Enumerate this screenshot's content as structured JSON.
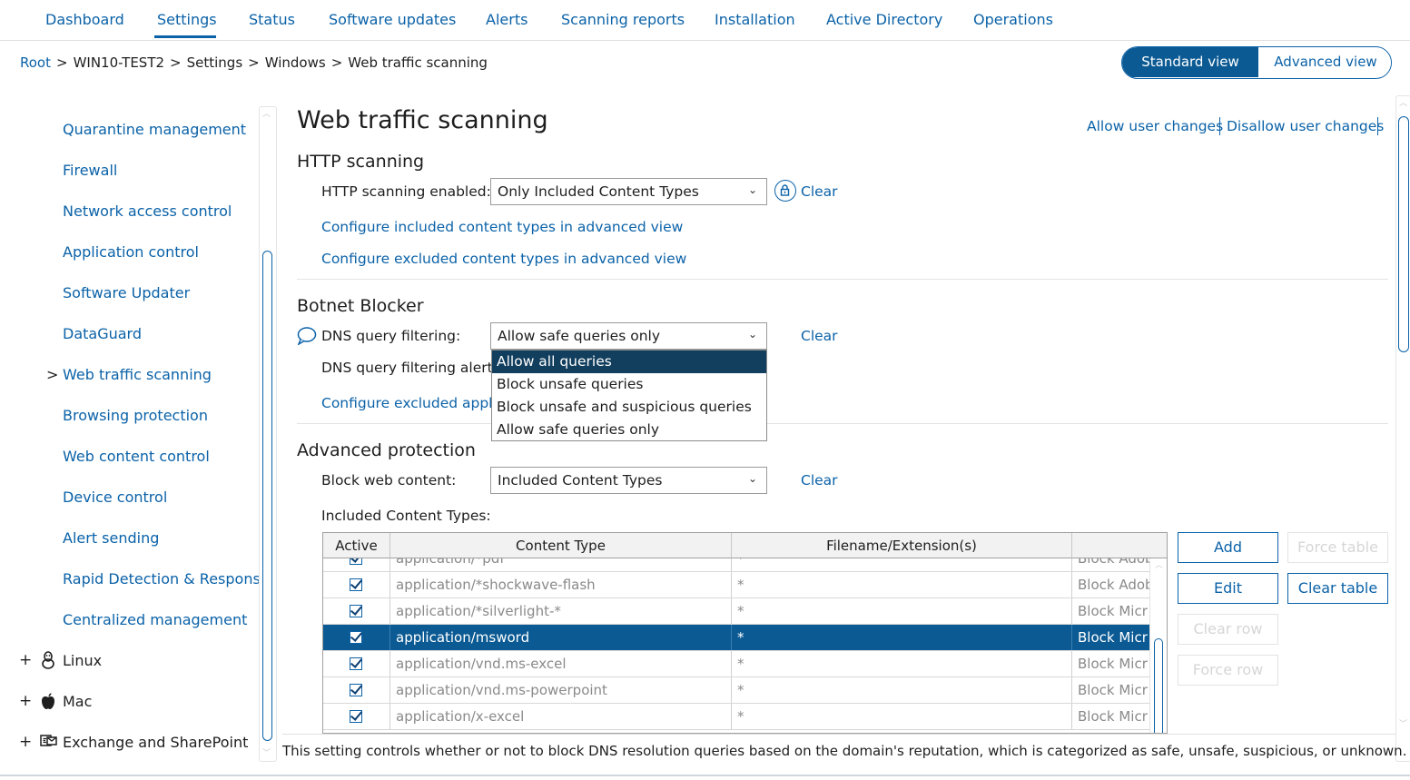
{
  "nav": {
    "tabs": [
      {
        "label": "Dashboard"
      },
      {
        "label": "Settings"
      },
      {
        "label": "Status"
      },
      {
        "label": "Software updates"
      },
      {
        "label": "Alerts"
      },
      {
        "label": "Scanning reports"
      },
      {
        "label": "Installation"
      },
      {
        "label": "Active Directory"
      },
      {
        "label": "Operations"
      }
    ],
    "active": "Settings"
  },
  "breadcrumb": {
    "items": [
      "Root",
      "WIN10-TEST2",
      "Settings",
      "Windows",
      "Web traffic scanning"
    ],
    "separator": ">"
  },
  "view_toggle": {
    "standard": "Standard view",
    "advanced": "Advanced view",
    "selected": "Standard view"
  },
  "sidebar": {
    "items": [
      {
        "label": "Quarantine management"
      },
      {
        "label": "Firewall"
      },
      {
        "label": "Network access control"
      },
      {
        "label": "Application control"
      },
      {
        "label": "Software Updater"
      },
      {
        "label": "DataGuard"
      },
      {
        "label": "Web traffic scanning",
        "expander": ">"
      },
      {
        "label": "Browsing protection"
      },
      {
        "label": "Web content control"
      },
      {
        "label": "Device control"
      },
      {
        "label": "Alert sending"
      },
      {
        "label": "Rapid Detection & Response"
      },
      {
        "label": "Centralized management"
      }
    ],
    "os_groups": [
      {
        "label": "Linux",
        "expander": "+",
        "icon": "linux-penguin-icon"
      },
      {
        "label": "Mac",
        "expander": "+",
        "icon": "apple-icon"
      },
      {
        "label": "Exchange and SharePoint",
        "expander": "+",
        "icon": "exchange-icon"
      }
    ]
  },
  "main": {
    "title": "Web traffic scanning",
    "allow_user_changes": "Allow user changes",
    "disallow_user_changes": "Disallow user changes",
    "http": {
      "title": "HTTP scanning",
      "enabled_label": "HTTP scanning enabled:",
      "enabled_value": "Only Included Content Types",
      "clear": "Clear",
      "configure_included": "Configure included content types in advanced view",
      "configure_excluded": "Configure excluded content types in advanced view"
    },
    "botnet": {
      "title": "Botnet Blocker",
      "dns_filter_label": "DNS query filtering:",
      "dns_filter_value": "Allow safe queries only",
      "clear": "Clear",
      "dns_alert_label": "DNS query filtering alert:",
      "configure_excluded_apps": "Configure excluded applic",
      "dropdown_options": [
        "Allow all queries",
        "Block unsafe queries",
        "Block unsafe and suspicious queries",
        "Allow safe queries only"
      ],
      "dropdown_highlighted": "Allow all queries"
    },
    "advanced": {
      "title": "Advanced protection",
      "block_label": "Block web content:",
      "block_value": "Included Content Types",
      "clear": "Clear",
      "included_label": "Included Content Types:",
      "table": {
        "headers": [
          "Active",
          "Content Type",
          "Filename/Extension(s)",
          ""
        ],
        "rows": [
          {
            "active": true,
            "content_type": "application/*pdf",
            "ext": "*",
            "action": "Block Adob"
          },
          {
            "active": true,
            "content_type": "application/*shockwave-flash",
            "ext": "*",
            "action": "Block Adob"
          },
          {
            "active": true,
            "content_type": "application/*silverlight-*",
            "ext": "*",
            "action": "Block Micr"
          },
          {
            "active": true,
            "content_type": "application/msword",
            "ext": "*",
            "action": "Block Micr",
            "selected": true
          },
          {
            "active": true,
            "content_type": "application/vnd.ms-excel",
            "ext": "*",
            "action": "Block Micr"
          },
          {
            "active": true,
            "content_type": "application/vnd.ms-powerpoint",
            "ext": "*",
            "action": "Block Micr"
          },
          {
            "active": true,
            "content_type": "application/x-excel",
            "ext": "*",
            "action": "Block Micr"
          }
        ]
      },
      "buttons": {
        "add": "Add",
        "force_table": "Force table",
        "edit": "Edit",
        "clear_table": "Clear table",
        "clear_row": "Clear row",
        "force_row": "Force row"
      }
    }
  },
  "status_text": "This setting controls whether or not to block DNS resolution queries based on the domain's reputation, which is categorized as safe, unsafe, suspicious, or unknown.",
  "colors": {
    "accent": "#0b62a8",
    "selected_row": "#0b5a93",
    "dropdown_highlight": "#123f5e"
  }
}
